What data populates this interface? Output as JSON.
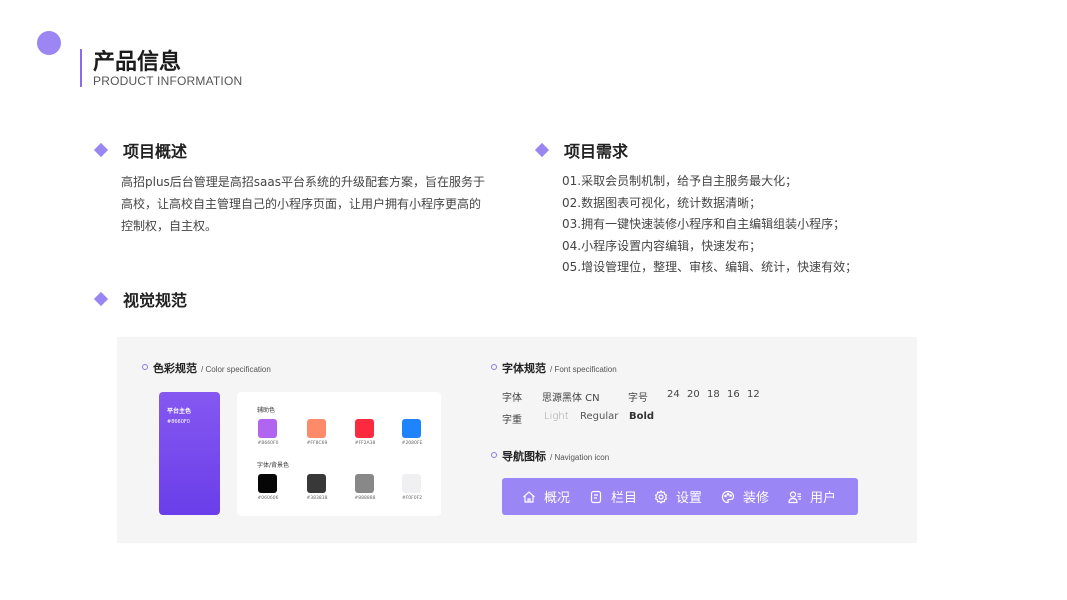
{
  "header": {
    "title": "产品信息",
    "subtitle": "PRODUCT INFORMATION"
  },
  "overview": {
    "title": "项目概述",
    "lines": [
      "高招plus后台管理是高招saas平台系统的升级配套方案，旨在服务于",
      "高校，让高校自主管理自己的小程序页面，让用户拥有小程序更高的",
      "控制权，自主权。"
    ]
  },
  "requirements": {
    "title": "项目需求",
    "items": [
      "01.采取会员制机制，给予自主服务最大化；",
      "02.数据图表可视化，统计数据清晰；",
      "03.拥有一键快速装修小程序和自主编辑组装小程序；",
      "04.小程序设置内容编辑，快速发布；",
      "05.增设管理位，整理、审核、编辑、统计，快速有效；"
    ]
  },
  "visual": {
    "title": "视觉规范",
    "color_spec": {
      "title": "色彩规范",
      "en": "/ Color specification",
      "main_label": "平台主色",
      "main_hex": "#8660F0",
      "aux_label": "辅助色",
      "aux_colors": [
        {
          "hex": "#B660F0",
          "color": "#b064ef"
        },
        {
          "hex": "#FF8C69",
          "color": "#fd8b6a"
        },
        {
          "hex": "#FF2A38",
          "color": "#fc2a3f"
        },
        {
          "hex": "#2080FE",
          "color": "#1f84fc"
        }
      ],
      "text_label": "字体/背景色",
      "text_colors": [
        {
          "hex": "#060606",
          "color": "#060606"
        },
        {
          "hex": "#383838",
          "color": "#383838"
        },
        {
          "hex": "#888888",
          "color": "#888888"
        },
        {
          "hex": "#F0F0F2",
          "color": "#f0f0f2"
        }
      ]
    },
    "font_spec": {
      "title": "字体规范",
      "en": "/ Font specification",
      "font_label": "字体",
      "font_name": "思源黑体 CN",
      "size_label": "字号",
      "sizes": [
        "24",
        "20",
        "18",
        "16",
        "12"
      ],
      "weight_label": "字重",
      "weights": [
        "Light",
        "Regular",
        "Bold"
      ]
    },
    "nav_spec": {
      "title": "导航图标",
      "en": "/ Navigation icon",
      "items": [
        {
          "label": "概况",
          "icon": "home-icon"
        },
        {
          "label": "栏目",
          "icon": "column-icon"
        },
        {
          "label": "设置",
          "icon": "gear-icon"
        },
        {
          "label": "装修",
          "icon": "palette-icon"
        },
        {
          "label": "用户",
          "icon": "user-icon"
        }
      ]
    }
  },
  "colors": {
    "accent": "#9A86F2",
    "nav_bg": "#9A86F4",
    "panel_bg": "#F5F5F6"
  }
}
